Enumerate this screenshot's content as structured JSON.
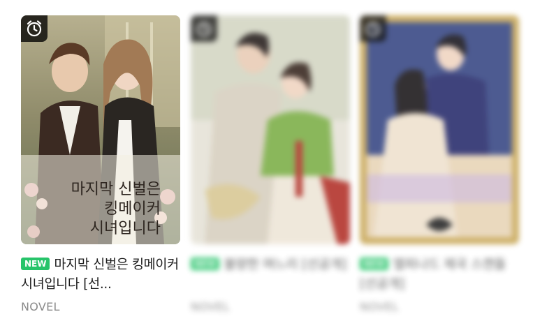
{
  "cards": [
    {
      "badge": "NEW",
      "title": "마지막 신벌은 킹메이커 시녀입니다 [선...",
      "category": "NOVEL",
      "cover_text": [
        "마지막 신벌은",
        "킹메이커",
        "시녀입니다"
      ],
      "timer_icon": "alarm-clock-icon",
      "blurred": false
    },
    {
      "badge": "NEW",
      "title": "불량한 며느리 [선공개]",
      "category": "NOVEL",
      "timer_icon": "alarm-clock-icon",
      "blurred": true
    },
    {
      "badge": "NEW",
      "title": "엘피나드 제국 스캔들 [선공개]",
      "category": "NOVEL",
      "timer_icon": "alarm-clock-icon",
      "blurred": true
    }
  ],
  "colors": {
    "badge": "#27c46a",
    "category": "#8a8a8a",
    "title": "#1b1b1b"
  }
}
